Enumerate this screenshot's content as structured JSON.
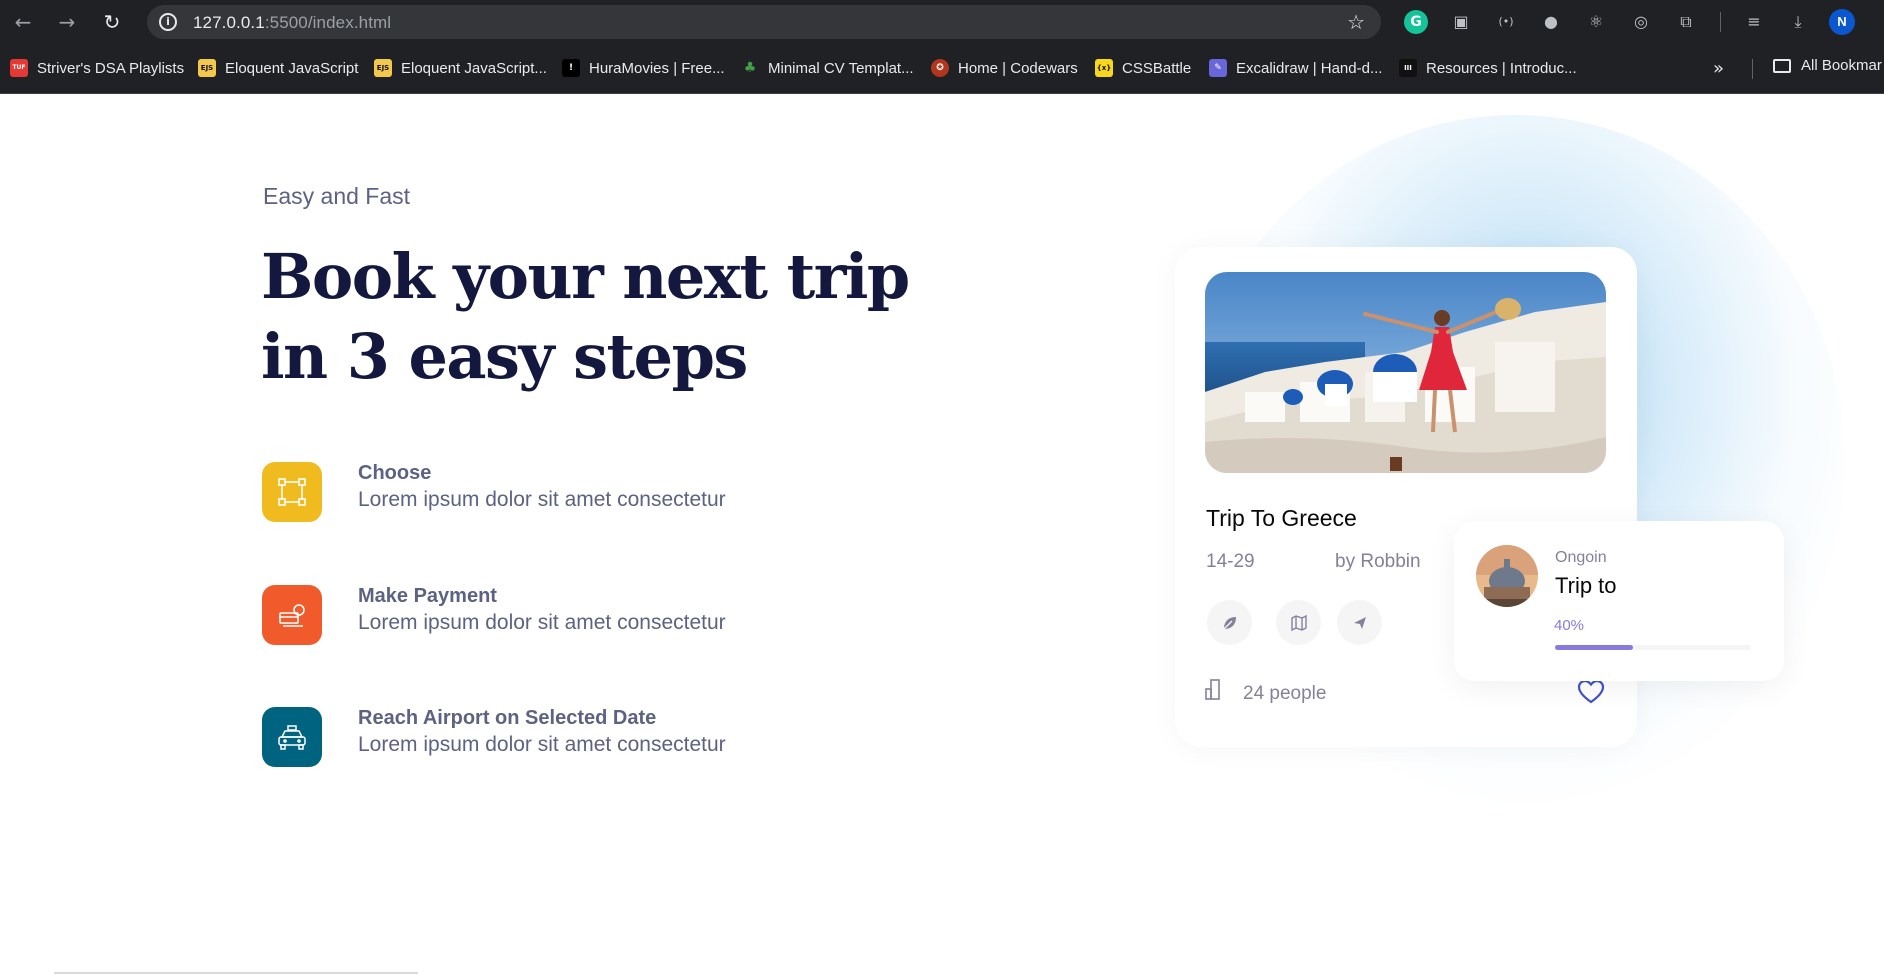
{
  "browser": {
    "url_host": "127.0.0.1",
    "url_rest": ":5500/index.html",
    "avatar_letter": "N",
    "bookmarks": [
      {
        "label": "Striver's DSA Playlists",
        "icon": "tuf-favicon",
        "color": "#e53935",
        "badge": "TUF"
      },
      {
        "label": "Eloquent JavaScript",
        "icon": "ejs-favicon",
        "color": "#f2c94c",
        "badge": "EJS"
      },
      {
        "label": "Eloquent JavaScript...",
        "icon": "ejs-favicon",
        "color": "#f2c94c",
        "badge": "EJS"
      },
      {
        "label": "HuraMovies | Free...",
        "icon": "hura-favicon",
        "color": "#000000",
        "badge": "!"
      },
      {
        "label": "Minimal CV Templat...",
        "icon": "leaf-favicon",
        "color": "#43a047",
        "badge": "♣"
      },
      {
        "label": "Home | Codewars",
        "icon": "codewars-favicon",
        "color": "#b1361e",
        "badge": "✪"
      },
      {
        "label": "CSSBattle",
        "icon": "cssbattle-favicon",
        "color": "#f9d71c",
        "badge": "{x}"
      },
      {
        "label": "Excalidraw | Hand-d...",
        "icon": "excalidraw-favicon",
        "color": "#6965db",
        "badge": "✎"
      },
      {
        "label": "Resources | Introduc...",
        "icon": "resources-favicon",
        "color": "#111111",
        "badge": "III"
      }
    ],
    "all_bookmarks": "All Bookmar"
  },
  "hero": {
    "subtitle": "Easy and Fast",
    "headline": "Book your next trip in 3 easy steps"
  },
  "steps": [
    {
      "title": "Choose",
      "desc": "Lorem ipsum dolor sit amet consectetur",
      "icon": "selection-icon",
      "color": "#f0bb1f"
    },
    {
      "title": "Make Payment",
      "desc": "Lorem ipsum dolor sit amet consectetur",
      "icon": "payment-icon",
      "color": "#f15a2b"
    },
    {
      "title": "Reach Airport on Selected Date",
      "desc": "Lorem ipsum dolor sit amet consectetur",
      "icon": "taxi-icon",
      "color": "#006380"
    }
  ],
  "trip_card": {
    "title": "Trip To Greece",
    "dates": "14-29",
    "by": "by Robbin",
    "people": "24 people",
    "actions": [
      "leaf-icon",
      "map-icon",
      "send-icon"
    ]
  },
  "ongoing": {
    "label": "Ongoin",
    "name": "Trip to",
    "percent_label": "40%",
    "progress": 0.4
  },
  "colors": {
    "heading": "#14183e",
    "text": "#5e6282",
    "accent": "#8a79df",
    "heart": "#4152ca"
  }
}
